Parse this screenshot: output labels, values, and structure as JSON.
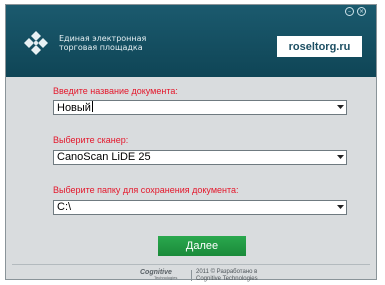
{
  "header": {
    "window_controls": [
      "minimize-icon",
      "close-icon"
    ],
    "brand_line1": "Единая электронная",
    "brand_line2": "торговая площадка",
    "site": "roseltorg.ru"
  },
  "form": {
    "doc_name_label": "Введите название документа:",
    "doc_name_value": "Новый",
    "scanner_label": "Выберите сканер:",
    "scanner_value": "CanoScan LiDE 25",
    "folder_label": "Выберите папку для сохранения документа:",
    "folder_value": "C:\\",
    "next_label": "Далее"
  },
  "footer": {
    "logo_text": "Cognitive",
    "logo_tagline": "Technologies",
    "copyright_line1": "2011 © Разработано в",
    "copyright_line2": "Cognitive Technologies"
  },
  "colors": {
    "header_bg": "#17536a",
    "label_red": "#e4172b",
    "button_green": "#22a047"
  }
}
